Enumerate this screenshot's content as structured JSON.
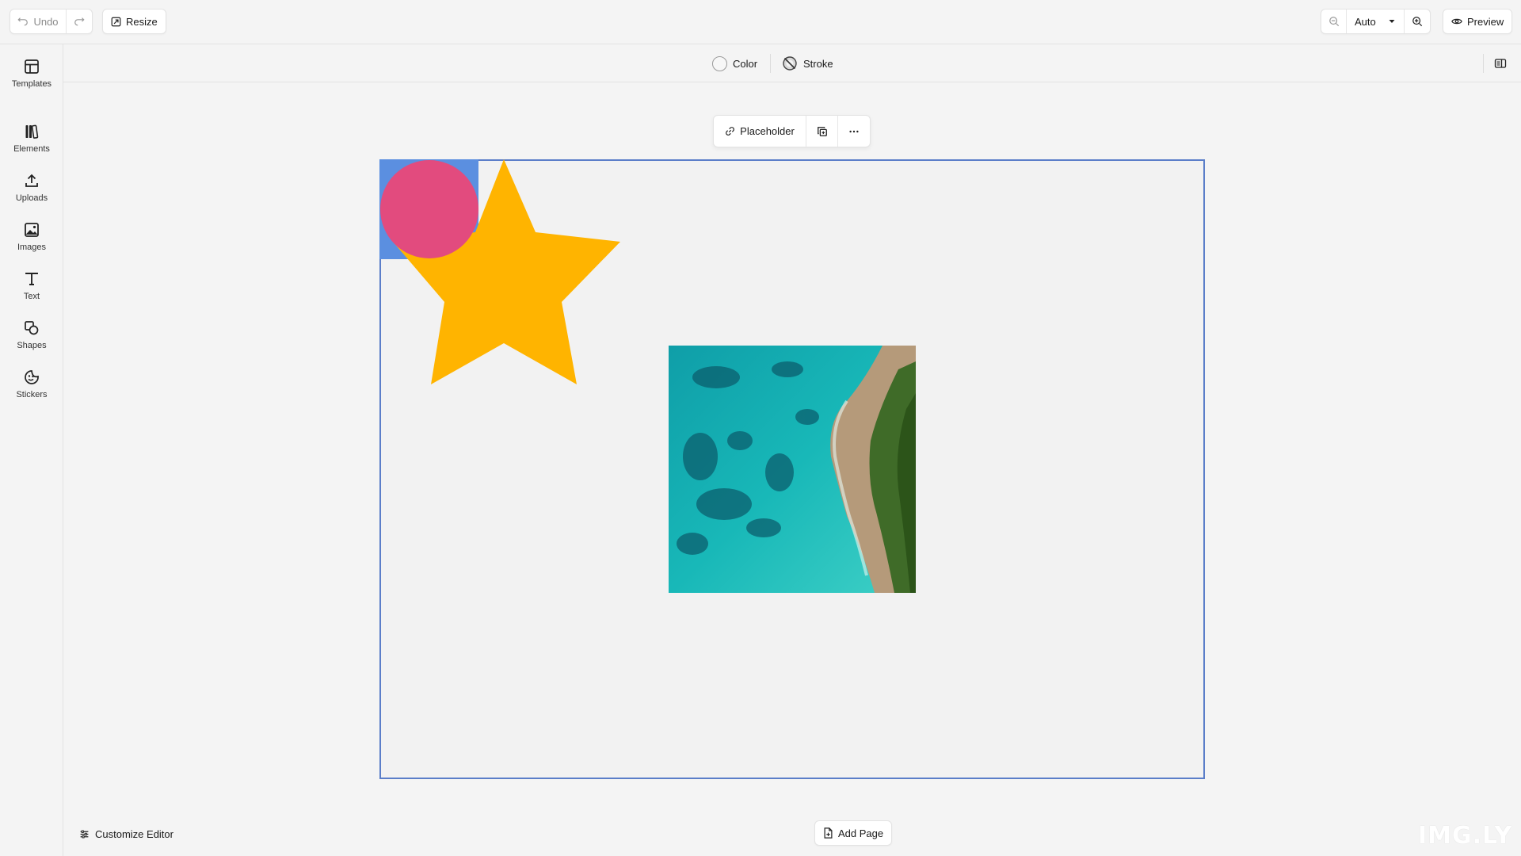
{
  "topbar": {
    "undo_label": "Undo",
    "resize_label": "Resize",
    "zoom_value": "Auto",
    "preview_label": "Preview"
  },
  "sidebar": {
    "items": [
      {
        "label": "Templates",
        "icon": "templates-icon"
      },
      {
        "label": "Elements",
        "icon": "elements-icon"
      },
      {
        "label": "Uploads",
        "icon": "upload-icon"
      },
      {
        "label": "Images",
        "icon": "image-icon"
      },
      {
        "label": "Text",
        "icon": "text-icon"
      },
      {
        "label": "Shapes",
        "icon": "shapes-icon"
      },
      {
        "label": "Stickers",
        "icon": "sticker-icon"
      }
    ]
  },
  "inspector_bar": {
    "color_label": "Color",
    "stroke_label": "Stroke"
  },
  "canvas_toolbar": {
    "placeholder_label": "Placeholder"
  },
  "canvas": {
    "circle_color": "#e24b7e",
    "star_color": "#ffb400",
    "selection_color": "#5b8fe0",
    "page_border_color": "#5b7ec9"
  },
  "footer": {
    "customize_label": "Customize Editor",
    "add_page_label": "Add Page",
    "watermark": "IMG.LY"
  }
}
